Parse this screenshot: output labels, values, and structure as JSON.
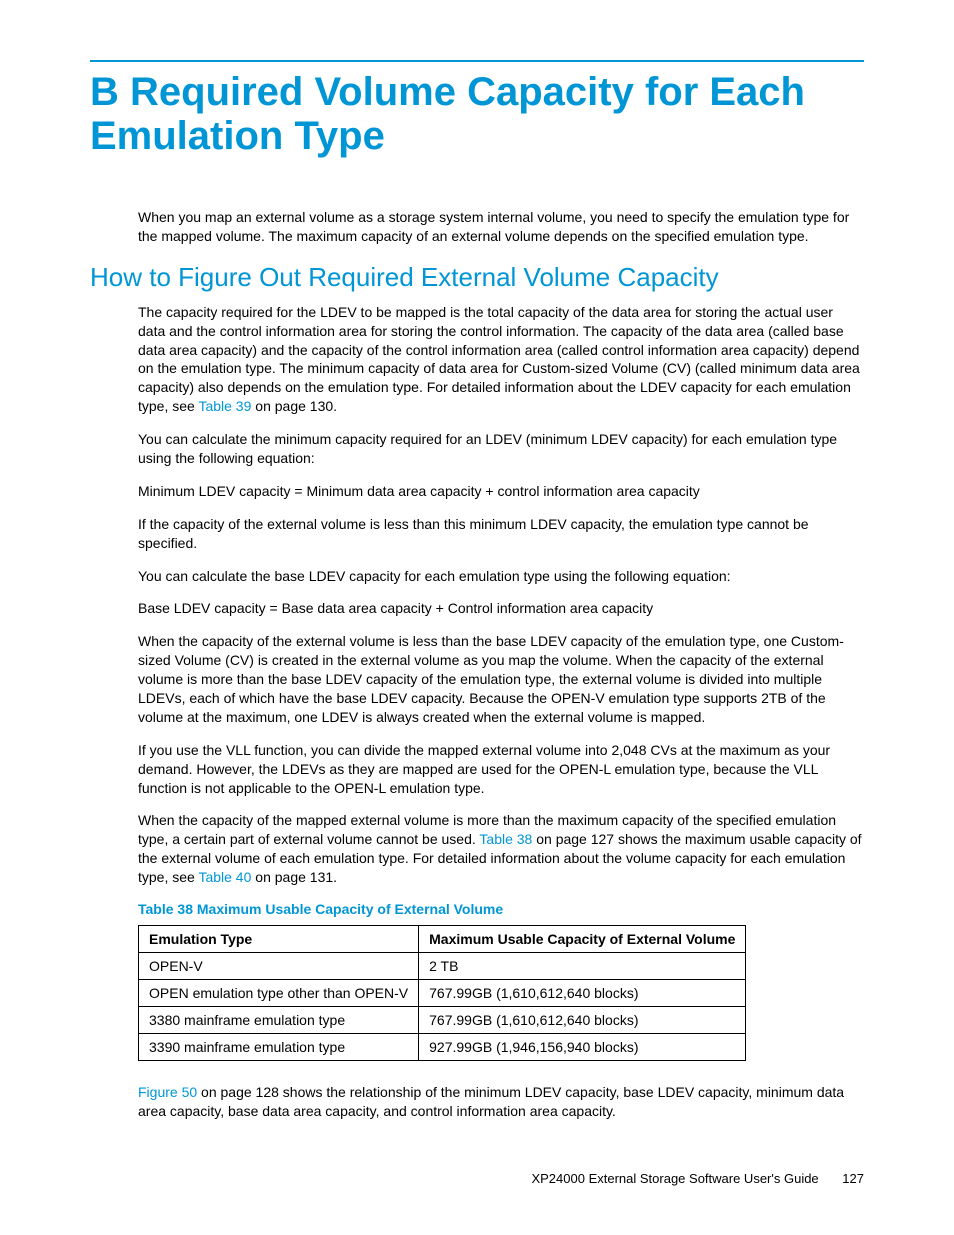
{
  "title": "B Required Volume Capacity for Each Emulation Type",
  "intro": "When you map an external volume as a storage system internal volume, you need to specify the emulation type for the mapped volume. The maximum capacity of an external volume depends on the specified emulation type.",
  "section_heading": "How to Figure Out Required External Volume Capacity",
  "p1a": "The capacity required for the LDEV to be mapped is the total capacity of the data area for storing the actual user data and the control information area for storing the control information. The capacity of the data area (called base data area capacity) and the capacity of the control information area (called control information area capacity) depend on the emulation type. The minimum capacity of data area for Custom-sized Volume (CV) (called minimum data area capacity) also depends on the emulation type. For detailed information about the LDEV capacity for each emulation type, see ",
  "p1_link": "Table 39",
  "p1b": " on page 130.",
  "p2": "You can calculate the minimum capacity required for an LDEV (minimum LDEV capacity) for each emulation type using the following equation:",
  "p3": "Minimum LDEV capacity = Minimum data area capacity + control information area capacity",
  "p4": "If the capacity of the external volume is less than this minimum LDEV capacity, the emulation type cannot be specified.",
  "p5": "You can calculate the base LDEV capacity for each emulation type using the following equation:",
  "p6": "Base LDEV capacity = Base data area capacity + Control information area capacity",
  "p7": "When the capacity of the external volume is less than the base LDEV capacity of the emulation type, one Custom-sized Volume (CV) is created in the external volume as you map the volume. When the capacity of the external volume is more than the base LDEV capacity of the emulation type, the external volume is divided into multiple LDEVs, each of which have the base LDEV capacity. Because the OPEN-V emulation type supports 2TB of the volume at the maximum, one LDEV is always created when the external volume is mapped.",
  "p8": "If you use the VLL function, you can divide the mapped external volume into 2,048 CVs at the maximum as your demand. However, the LDEVs as they are mapped are used for the OPEN-L emulation type, because the VLL function is not applicable to the OPEN-L emulation type.",
  "p9a": "When the capacity of the mapped external volume is more than the maximum capacity of the specified emulation type, a certain part of external volume cannot be used. ",
  "p9_link1": "Table 38",
  "p9b": " on page 127 shows the maximum usable capacity of the external volume of each emulation type. For detailed information about the volume capacity for each emulation type, see ",
  "p9_link2": "Table 40",
  "p9c": " on page 131.",
  "table_caption": "Table 38 Maximum Usable Capacity of External Volume",
  "table": {
    "headers": [
      "Emulation Type",
      "Maximum Usable Capacity of External Volume"
    ],
    "rows": [
      [
        "OPEN-V",
        "2 TB"
      ],
      [
        "OPEN emulation type other than OPEN-V",
        "767.99GB (1,610,612,640 blocks)"
      ],
      [
        "3380 mainframe emulation type",
        "767.99GB (1,610,612,640 blocks)"
      ],
      [
        "3390 mainframe emulation type",
        "927.99GB (1,946,156,940 blocks)"
      ]
    ]
  },
  "p10_link": "Figure 50",
  "p10": " on page 128 shows the relationship of the minimum LDEV capacity, base LDEV capacity, minimum data area capacity, base data area capacity, and control information area capacity.",
  "footer_title": "XP24000 External Storage Software User's Guide",
  "footer_page": "127"
}
